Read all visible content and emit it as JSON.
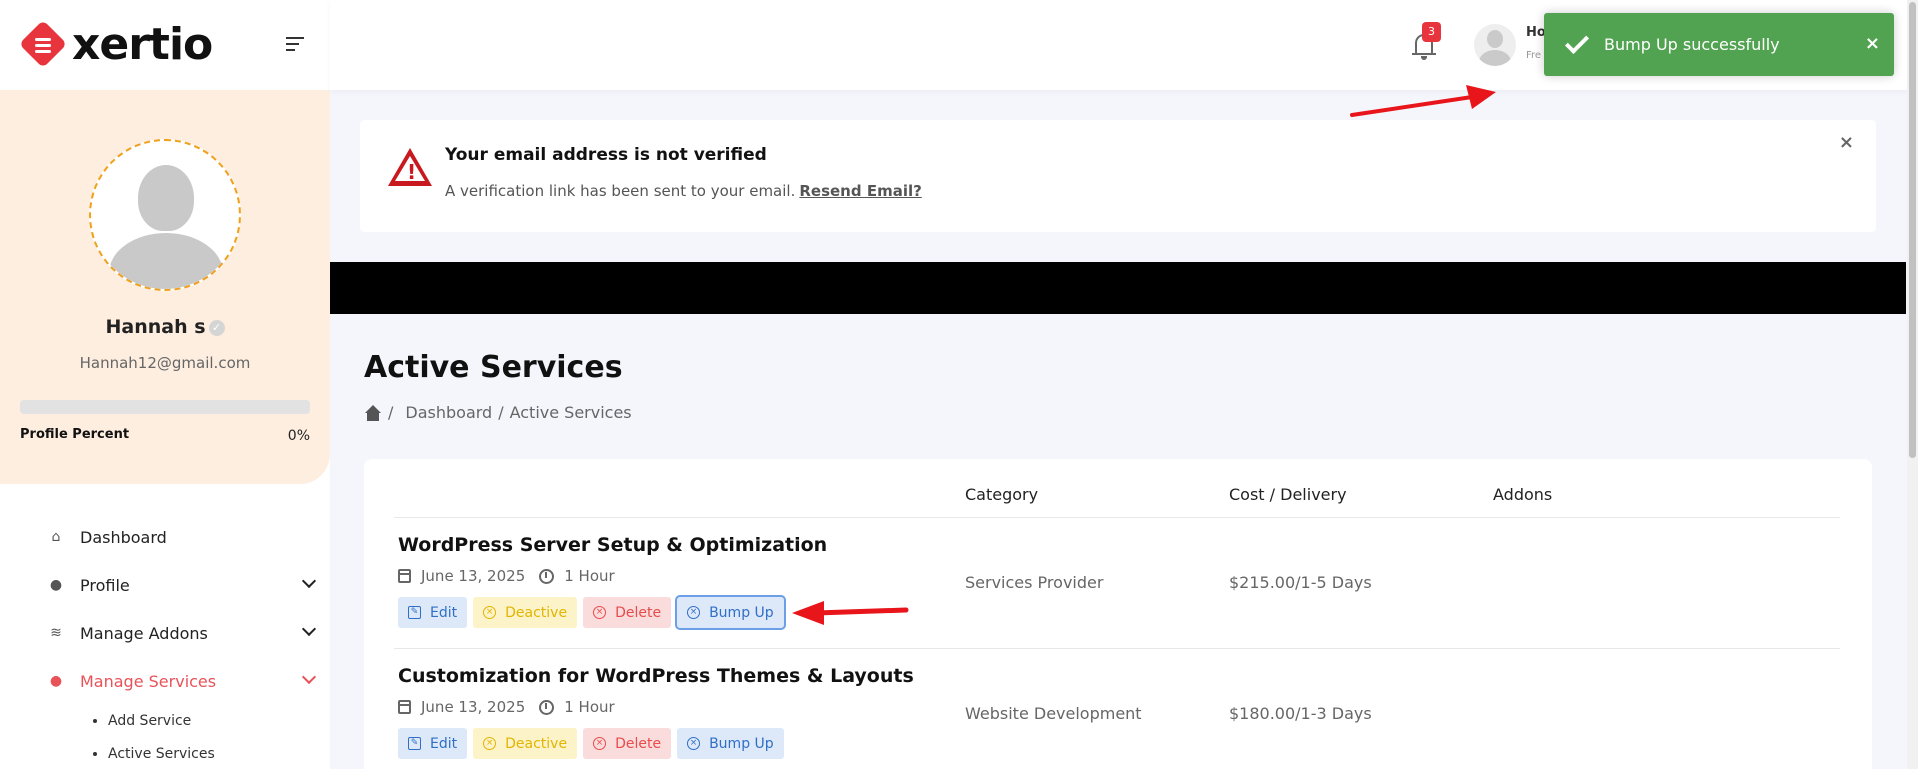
{
  "brand": {
    "logo_text": "xertio"
  },
  "sidebar": {
    "user": {
      "name": "Hannah s",
      "email": "Hannah12@gmail.com"
    },
    "profile_percent": {
      "label": "Profile Percent",
      "value": "0%",
      "fraction": 0
    },
    "menu": [
      {
        "label": "Dashboard",
        "icon": "home-icon",
        "has_chevron": false,
        "active": false
      },
      {
        "label": "Profile",
        "icon": "user-icon",
        "has_chevron": true,
        "active": false
      },
      {
        "label": "Manage Addons",
        "icon": "layers-icon",
        "has_chevron": true,
        "active": false
      },
      {
        "label": "Manage Services",
        "icon": "user-gear-icon",
        "has_chevron": true,
        "active": true
      }
    ],
    "submenu": [
      "Add Service",
      "Active Services"
    ]
  },
  "topbar": {
    "notifications_count": "3",
    "user_name": "Ho",
    "user_role": "Fre"
  },
  "toast": {
    "message": "Bump Up successfully",
    "close": "×",
    "color": "#51a351"
  },
  "alert": {
    "title": "Your email address is not verified",
    "text": "A verification link has been sent to your email.",
    "link": "Resend Email?",
    "close": "×"
  },
  "page": {
    "title": "Active Services",
    "breadcrumb": {
      "dashboard": "Dashboard",
      "sep": "/",
      "current": "Active Services"
    }
  },
  "table": {
    "headers": {
      "category": "Category",
      "cost": "Cost / Delivery",
      "addons": "Addons"
    },
    "rows": [
      {
        "title": "WordPress Server Setup & Optimization",
        "date": "June 13, 2025",
        "duration": "1 Hour",
        "category": "Services Provider",
        "cost": "$215.00/1-5 Days",
        "addons": ""
      },
      {
        "title": "Customization for WordPress Themes & Layouts",
        "date": "June 13, 2025",
        "duration": "1 Hour",
        "category": "Website Development",
        "cost": "$180.00/1-3 Days",
        "addons": ""
      }
    ],
    "buttons": {
      "edit": "Edit",
      "deactive": "Deactive",
      "delete": "Delete",
      "bump": "Bump Up"
    }
  },
  "colors": {
    "accent": "#e8343d",
    "sidebar_card": "#fdeee0",
    "annotation_arrow": "#e8151b"
  }
}
